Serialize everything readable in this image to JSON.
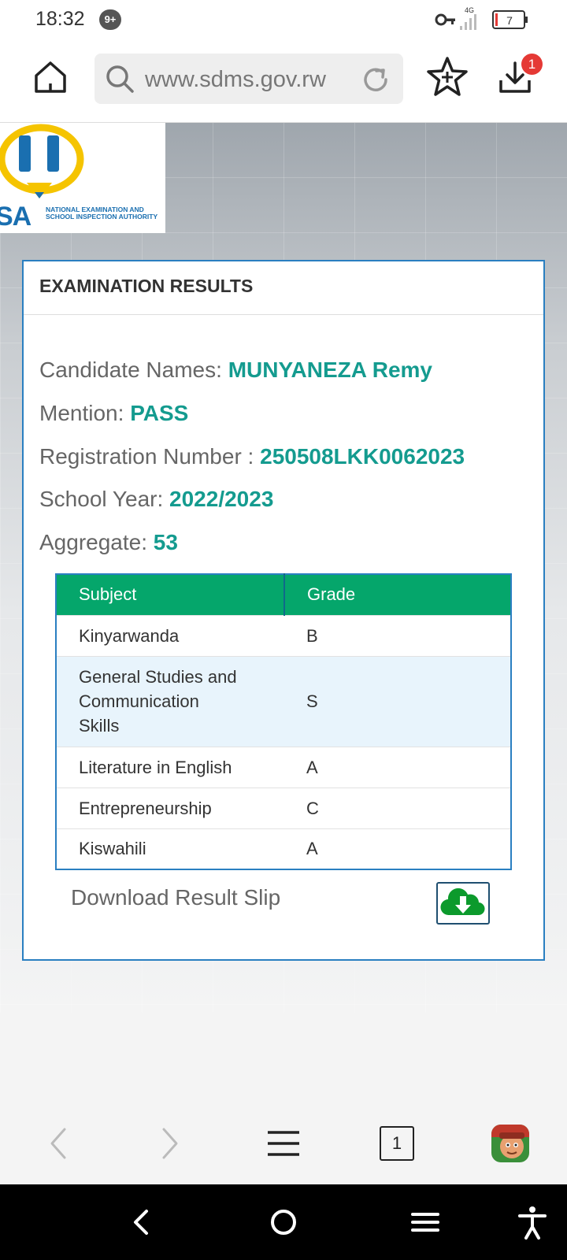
{
  "status_bar": {
    "time": "18:32",
    "notification_count": "9+",
    "network": "4G",
    "battery": "7"
  },
  "browser": {
    "url": "www.sdms.gov.rw",
    "download_count": "1",
    "tab_count": "1"
  },
  "logo": {
    "acronym_visible": "SA",
    "text": "NATIONAL EXAMINATION AND SCHOOL INSPECTION AUTHORITY"
  },
  "results": {
    "title": "EXAMINATION RESULTS",
    "candidate_label": "Candidate Names:",
    "candidate_value": "MUNYANEZA Remy",
    "mention_label": "Mention:",
    "mention_value": "PASS",
    "registration_label": "Registration Number :",
    "registration_value": "250508LKK0062023",
    "school_year_label": "School Year:",
    "school_year_value": "2022/2023",
    "aggregate_label": "Aggregate:",
    "aggregate_value": "53",
    "table_headers": [
      "Subject",
      "Grade"
    ],
    "rows": [
      {
        "subject_lines": [
          "Kinyarwanda"
        ],
        "grade": "B"
      },
      {
        "subject_lines": [
          "General Studies and",
          "Communication",
          "Skills"
        ],
        "grade": "S"
      },
      {
        "subject_lines": [
          "Literature in English"
        ],
        "grade": "A"
      },
      {
        "subject_lines": [
          "Entrepreneurship"
        ],
        "grade": "C"
      },
      {
        "subject_lines": [
          "Kiswahili"
        ],
        "grade": "A"
      }
    ],
    "download_label": "Download Result Slip"
  },
  "colors": {
    "accent_teal": "#149b8f",
    "table_header_green": "#05a66b",
    "card_border_blue": "#2a7fc1",
    "download_icon_green": "#0c9a2c"
  },
  "icons": {
    "home": "home-icon",
    "search": "search-icon",
    "reload": "reload-icon",
    "bookmark": "star-plus-icon",
    "download": "download-icon",
    "cloud_download": "cloud-download-icon"
  }
}
